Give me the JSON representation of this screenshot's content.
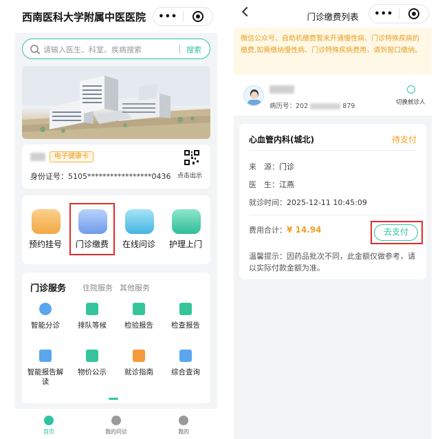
{
  "left": {
    "title": "西南医科大学附属中医医院",
    "capsule": {
      "more": "•••"
    },
    "search": {
      "placeholder": "请输入医生、科室、疾病搜索",
      "button": "搜索"
    },
    "card": {
      "health_tag": "电子健康卡",
      "id_text": "身份证号：5105*****************0436",
      "qr_hint": "点击出示"
    },
    "quick": [
      {
        "label": "预约挂号",
        "color": "#f5b45a"
      },
      {
        "label": "门诊缴费",
        "color": "#7aa8f0"
      },
      {
        "label": "在线问诊",
        "color": "#56c0e8"
      },
      {
        "label": "护理上门",
        "color": "#3cc9a6"
      }
    ],
    "service_tabs": [
      "门诊服务",
      "住院服务",
      "其他服务"
    ],
    "services": [
      {
        "label": "智能分诊",
        "color": "#5aa6ef"
      },
      {
        "label": "排队等候",
        "color": "#35c49b"
      },
      {
        "label": "检验报告",
        "color": "#35c49b"
      },
      {
        "label": "检查报告",
        "color": "#35c49b"
      },
      {
        "label": "智能报告解读",
        "color": "#5aa6ef"
      },
      {
        "label": "物价公示",
        "color": "#35c49b"
      },
      {
        "label": "就诊指南",
        "color": "#f39a3d"
      },
      {
        "label": "综合查询",
        "color": "#5aa6ef"
      }
    ],
    "tabbar": [
      {
        "label": "首页",
        "color": "#2ec4a0"
      },
      {
        "label": "我的问诊",
        "color": "#9a9a9a"
      },
      {
        "label": "我的",
        "color": "#9a9a9a"
      }
    ]
  },
  "right": {
    "title": "门诊缴费列表",
    "capsule": {
      "more": "•••"
    },
    "notice": "微信公众号、自助机缴费暂未开通慢性病、门诊特殊疾病的缴费,如需缴纳慢性病、门诊特殊疾病费用，请到窗口缴纳。",
    "patient": {
      "record_label": "病历号：202",
      "record_tail": "879",
      "switch": "切换就诊人"
    },
    "bill": {
      "dept": "心血管内科(城北)",
      "status": "待支付",
      "source_label": "来　源：",
      "source": "门诊",
      "doctor_label": "医　生：",
      "doctor": "江燕",
      "time_label": "就诊时间：",
      "time": "2025-12-11 10:45:09",
      "fee_label": "费用合计：",
      "fee": "¥ 14.94",
      "pay_button": "去支付",
      "tip": "温馨提示：因药品批次不同，此金额仅做参考，请以实际付款金额为准。"
    }
  }
}
